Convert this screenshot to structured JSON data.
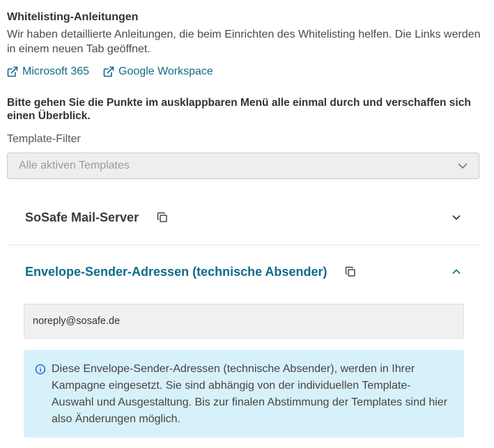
{
  "whitelisting": {
    "title": "Whitelisting-Anleitungen",
    "intro": "Wir haben detaillierte Anleitungen, die beim Einrichten des Whitelisting helfen. Die Links werden in einem neuen Tab geöffnet.",
    "links": [
      {
        "label": "Microsoft 365",
        "icon": "external-link-icon"
      },
      {
        "label": "Google Workspace",
        "icon": "external-link-icon"
      }
    ]
  },
  "note": "Bitte gehen Sie die Punkte im ausklappbaren Menü alle einmal durch und verschaffen sich einen Überblick.",
  "filter": {
    "label": "Template-Filter",
    "selected": "Alle aktiven Templates"
  },
  "accordions": [
    {
      "title": "SoSafe Mail-Server",
      "expanded": false
    },
    {
      "title": "Envelope-Sender-Adressen (technische Absender)",
      "expanded": true
    }
  ],
  "envelope_sender": {
    "address": "noreply@sosafe.de",
    "info": "Diese Envelope-Sender-Adressen (technische Absender), werden in Ihrer Kampagne eingesetzt. Sie sind abhängig von der individuellen Template-Auswahl und Ausgestaltung. Bis zur finalen Abstimmung der Templates sind hier also Änderungen möglich."
  },
  "colors": {
    "link": "#0e6b8a",
    "info_bg": "#d7f1fb",
    "select_bg": "#eeeeee"
  }
}
